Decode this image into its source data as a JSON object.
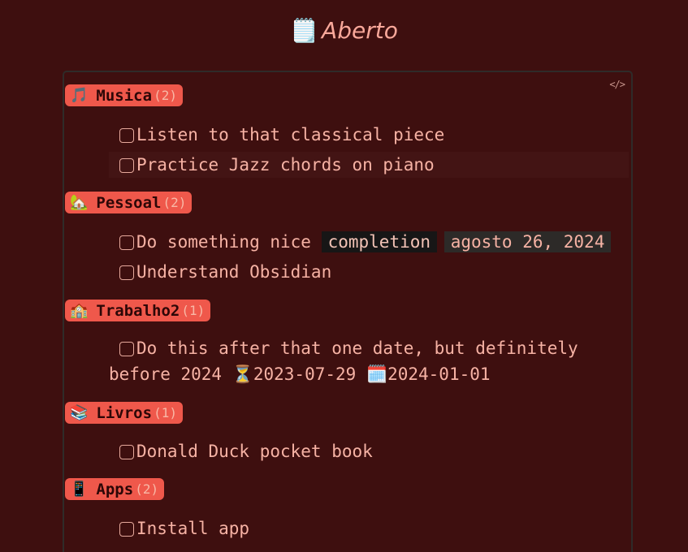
{
  "page": {
    "title": "Aberto",
    "title_icon": "🗒️"
  },
  "panel": {
    "code_icon": "</>"
  },
  "groups": [
    {
      "emoji": "🎵",
      "name": "Musica",
      "count": "(2)",
      "tasks": [
        {
          "text": "Listen to that classical piece"
        },
        {
          "text": "Practice Jazz chords on piano"
        }
      ]
    },
    {
      "emoji": "🏡",
      "name": "Pessoal",
      "count": "(2)",
      "tasks": [
        {
          "text": "Do something nice",
          "chip_key": "completion",
          "chip_value": "agosto 26, 2024"
        },
        {
          "text": "Understand Obsidian"
        }
      ]
    },
    {
      "emoji": "🏫",
      "name": "Trabalho2",
      "count": "(1)",
      "tasks": [
        {
          "text": "Do this after that one date, but definitely before 2024 ⏳2023-07-29 🗓️2024-01-01"
        }
      ]
    },
    {
      "emoji": "📚",
      "name": "Livros",
      "count": "(1)",
      "tasks": [
        {
          "text": "Donald Duck pocket book"
        }
      ]
    },
    {
      "emoji": "📱",
      "name": "Apps",
      "count": "(2)",
      "tasks": [
        {
          "text": "Install app"
        }
      ]
    }
  ],
  "colors": {
    "background": "#3e0f0f",
    "header_badge": "#ef584b",
    "text": "#f6b2a4"
  }
}
